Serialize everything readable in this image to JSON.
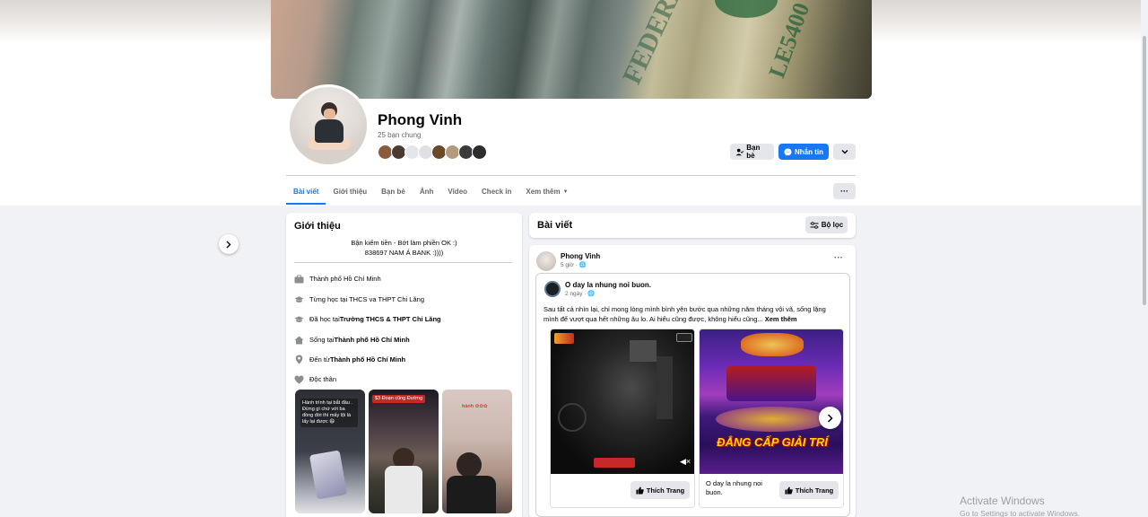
{
  "profile": {
    "name": "Phong Vinh",
    "mutual_friends": "25 bạn chung",
    "mutual_avatar_colors": [
      "#8a5a3b",
      "#4a3a30",
      "#e4e6eb",
      "#dfe1e5",
      "#6b4a2a",
      "#b39a7a",
      "#3a3a3a",
      "#2d2d2d"
    ]
  },
  "actions": {
    "friends_label": "Bạn bè",
    "message_label": "Nhắn tin"
  },
  "tabs": [
    {
      "label": "Bài viết",
      "active": true
    },
    {
      "label": "Giới thiệu"
    },
    {
      "label": "Bạn bè"
    },
    {
      "label": "Ảnh"
    },
    {
      "label": "Video"
    },
    {
      "label": "Check in"
    },
    {
      "label": "Xem thêm"
    }
  ],
  "intro": {
    "title": "Giới thiệu",
    "bio_line1": "Bận kiếm tiền - Bớt làm phiền OK :)",
    "bio_line2": "838697 NAM Á BANK :))))",
    "items": [
      {
        "icon": "briefcase-icon",
        "text": "Thành phố Hồ Chí Minh",
        "bold": ""
      },
      {
        "icon": "graduation-cap-icon",
        "text": "Từng học tại THCS va THPT Chi Lăng",
        "bold": ""
      },
      {
        "icon": "graduation-cap-icon",
        "text": "Đã học tại ",
        "bold": "Trường THCS & THPT Chi Lăng"
      },
      {
        "icon": "home-icon",
        "text": "Sống tại ",
        "bold": "Thành phố Hồ Chí Minh"
      },
      {
        "icon": "location-pin-icon",
        "text": "Đến từ ",
        "bold": "Thành phố Hồ Chí Minh"
      },
      {
        "icon": "heart-icon",
        "text": "Độc thân",
        "bold": ""
      }
    ],
    "story1_caption": "Hành trình tại bắt đầu . Đừng gì chứ với ba đồng đời thì mấy lội là lấy lại được 😄",
    "story2_caption": "$3 Đoạn cũng Đường",
    "story3_caption": "hành ✿✿✿"
  },
  "posts": {
    "title": "Bài viết",
    "filter_label": "Bộ lọc"
  },
  "post": {
    "author": "Phong Vinh",
    "time": "5 giờ · 🌐",
    "shared_page": "O day la nhung noi buon.",
    "shared_time": "2 ngày · 🌐",
    "text": "Sau tất cả nhìn lại, chỉ mong lòng mình bình yên bước qua những năm tháng vội vã, sống lặng mình để vượt qua hết những âu lo. Ai hiểu cũng được, không hiểu cũng... ",
    "see_more": "Xem thêm",
    "card1_label": "",
    "card2_label": "O day la nhung noi buon.",
    "like_label": "Thích Trang",
    "card2_banner": "ĐẲNG CẤP GIẢI TRÍ"
  },
  "watermark": {
    "line1": "Activate Windows",
    "line2": "Go to Settings to activate Windows."
  }
}
